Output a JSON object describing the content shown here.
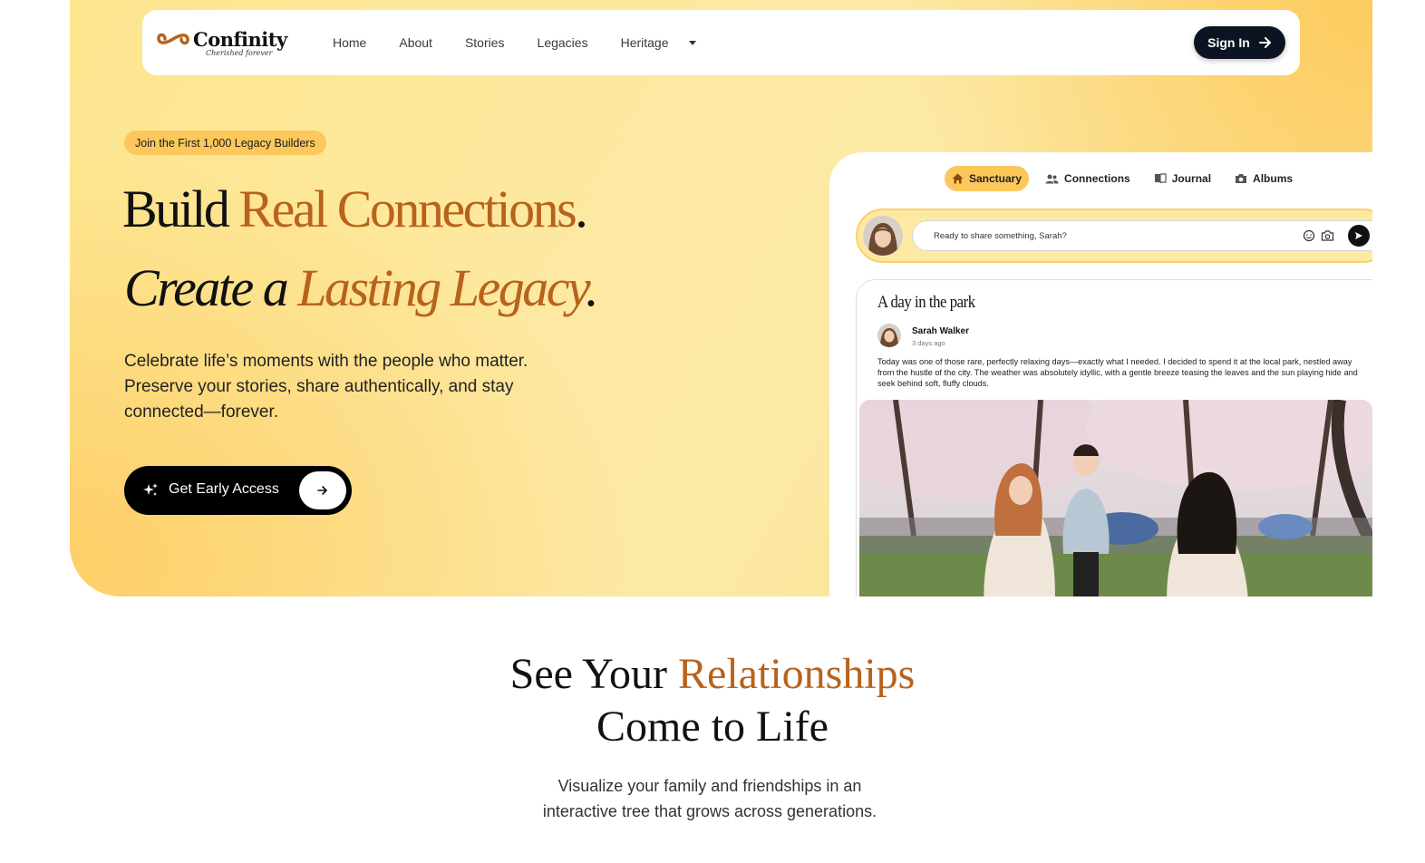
{
  "brand": {
    "name": "Confinity",
    "tagline": "Cherished forever"
  },
  "nav": {
    "links": [
      "Home",
      "About",
      "Stories",
      "Legacies",
      "Heritage"
    ],
    "signin_label": "Sign In"
  },
  "hero": {
    "badge": "Join the First 1,000 Legacy Builders",
    "headline1_plain": "Build ",
    "headline1_accent": "Real Connections",
    "headline1_end": ".",
    "headline2_plain": "Create a ",
    "headline2_accent": "Lasting Legacy",
    "headline2_end": ".",
    "description": "Celebrate life’s moments with the people who matter. Preserve your stories, share authentically, and stay connected—forever.",
    "cta_label": "Get Early Access"
  },
  "app": {
    "tabs": [
      {
        "label": "Sanctuary",
        "icon": "home-icon",
        "active": true
      },
      {
        "label": "Connections",
        "icon": "people-icon",
        "active": false
      },
      {
        "label": "Journal",
        "icon": "journal-icon",
        "active": false
      },
      {
        "label": "Albums",
        "icon": "camera-icon",
        "active": false
      }
    ],
    "composer_placeholder": "Ready to share something, Sarah?",
    "post": {
      "title": "A day in the park",
      "author": "Sarah Walker",
      "time": "3 days ago",
      "text": "Today was one of those rare, perfectly relaxing days—exactly what I needed. I decided to spend it at the local park, nestled away from the hustle of the city. The weather was absolutely idyllic, with a gentle breeze teasing the leaves and the sun playing hide and seek behind soft, fluffy clouds."
    }
  },
  "section": {
    "title_plain": "See Your ",
    "title_accent": "Relationships",
    "title_line2": "Come to Life",
    "description_line1": "Visualize your family and friendships in an",
    "description_line2": "interactive tree that grows across generations."
  },
  "colors": {
    "accent": "#b8621b",
    "badge": "#fcc85c",
    "dark": "#0c1322"
  }
}
